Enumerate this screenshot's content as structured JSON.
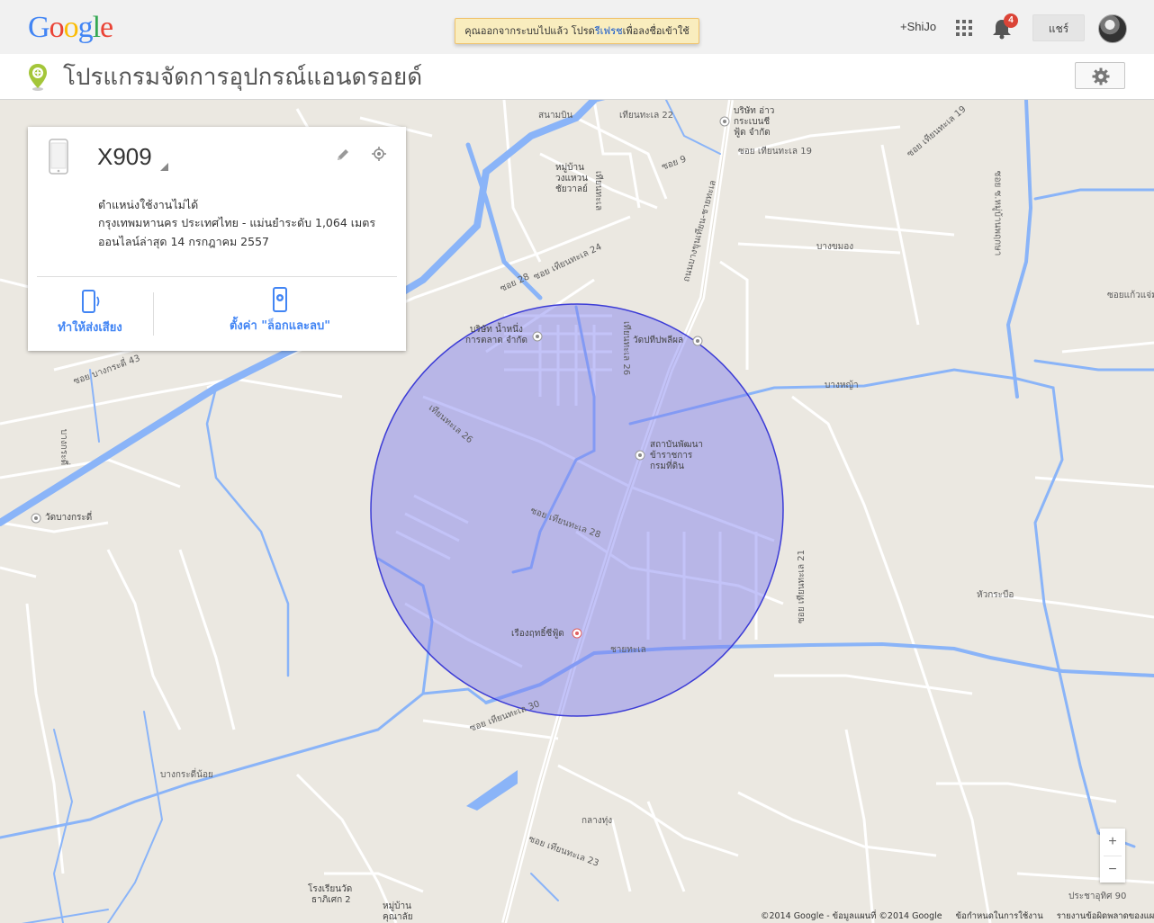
{
  "topbar": {
    "logo": [
      "G",
      "o",
      "o",
      "g",
      "l",
      "e"
    ],
    "logo_colors": [
      "#4285f4",
      "#ea4335",
      "#fbbc05",
      "#4285f4",
      "#34a853",
      "#ea4335"
    ],
    "notice_before": "คุณออกจากระบบไปแล้ว โปรด",
    "notice_link": "รีเฟรช",
    "notice_after": "เพื่อลงชื่อเข้าใช้",
    "profile_name": "+ShiJo",
    "notification_count": "4",
    "share_label": "แชร์"
  },
  "app": {
    "title": "โปรแกรมจัดการอุปกรณ์แอนดรอยด์"
  },
  "device": {
    "name": "X909",
    "status": "ตำแหน่งใช้งานไม่ได้",
    "location": "กรุงเทพมหานคร ประเทศไทย - แม่นยำระดับ 1,064 เมตร",
    "last_online": "ออนไลน์ล่าสุด 14 กรกฎาคม 2557",
    "ring_label": "ทำให้ส่งเสียง",
    "lock_label": "ตั้งค่า \"ล็อกและลบ\""
  },
  "map": {
    "accuracy_circle_color": "#5a5ae6",
    "labels": {
      "sanambin": "สนามบิน",
      "tienthale22": "เทียนทะเล 22",
      "company1": "บริษัท อ่าว",
      "company2": "กระเบนชี",
      "company3": "ฟู้ด จำกัด",
      "soi19": "ซอย เทียนทะเล 19",
      "soi19b": "ซอย เทียนทะเล 19",
      "moobaan1": "หมู่บ้าน",
      "moobaan2": "วงแหวน",
      "moobaan3": "ชัยวาลย์",
      "soi9": "ซอย 9",
      "tienthale": "เทียนทะเล",
      "bangkhamong": "บางขมอง",
      "thanon": "ถนนบางขุนเทียน-ชายทะเล",
      "soi24": "ซอย เทียนทะเล 24",
      "soi28a": "ซอย 28",
      "namnueng1": "บริษัท น้ำหนึ่ง",
      "namnueng2": "การตลาด จำกัด",
      "watthaiphlaphon": "วัดปทีปพลีผล",
      "bangyu": "บางหญ้า",
      "soi26": "เทียนทะเล 26",
      "soi26b": "เทียนทะเล 26",
      "institute1": "สถาบันพัฒนา",
      "institute2": "ข้าราชการ",
      "institute3": "กรมที่ดิน",
      "soi28": "ซอย เทียนทะเล 28",
      "watbangkradi": "วัดบางกระดี่",
      "bangkradi": "บางกระดี่",
      "soi43": "ซอย บางกระดี่ 43",
      "soi21": "ซอย เทียนทะเล 21",
      "huakrabue": "หัวกระบือ",
      "ruengrit": "เรืองฤทธิ์ซีฟู้ด",
      "chaitalay": "ชายทะเล",
      "soi30": "ซอย เทียนทะเล 30",
      "bangkradinoi": "บางกระดี่น้อย",
      "klangthung": "กลางทุ่ง",
      "soi23": "ซอย เทียนทะเล 23",
      "school1": "โรงเรียนวัด",
      "school2": "ธาภิเศก 2",
      "moobaan4": "หมู่บ้าน",
      "moobaan5": "คุณาลัย",
      "pracha": "ประชาอุทิศ 90",
      "chuenchom": "ซอยแก้วแจ่ม",
      "bangkhun": "ซอย ซ.หมู่บ้านพฤกษา"
    }
  },
  "zoom": {
    "in": "+",
    "out": "−"
  },
  "footer": {
    "copyright": "©2014 Google - ข้อมูลแผนที่ ©2014 Google",
    "terms": "ข้อกำหนดในการใช้งาน",
    "report": "รายงานข้อผิดพลาดของแผนที่"
  }
}
